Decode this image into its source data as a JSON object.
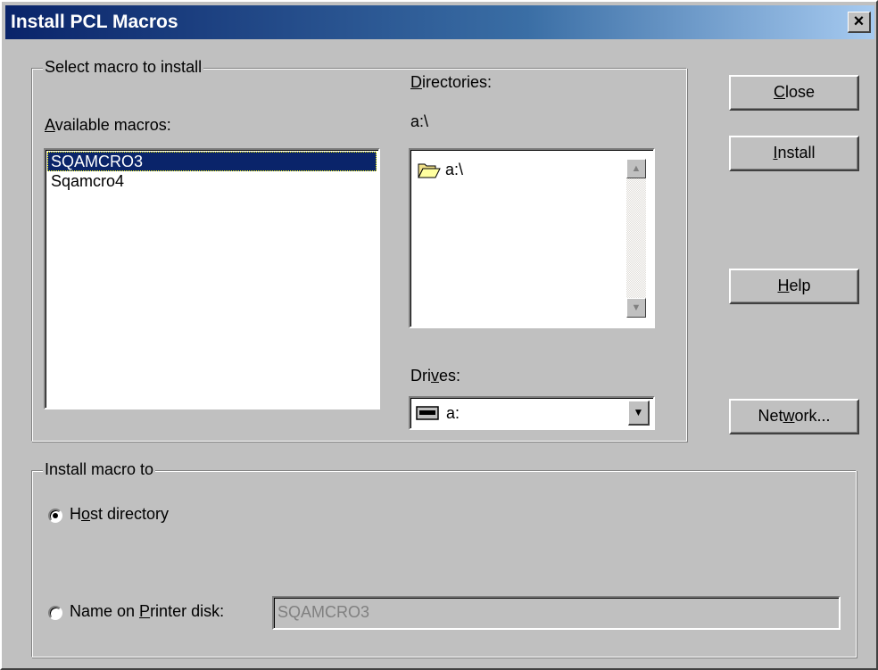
{
  "window": {
    "title": "Install PCL Macros",
    "close_glyph": "×"
  },
  "select_group": {
    "label": "Select macro to install",
    "available_label": "Available macros:",
    "macros": [
      {
        "name": "SQAMCRO3",
        "selected": true
      },
      {
        "name": "Sqamcro4",
        "selected": false
      }
    ],
    "directories_label": "Directories:",
    "current_path": "a:\\",
    "directory_items": [
      {
        "name": "a:\\",
        "icon": "open-folder-icon"
      }
    ],
    "drives_label": "Drives:",
    "drive_value": "a:",
    "drive_icon": "floppy-drive-icon"
  },
  "buttons": {
    "close": "Close",
    "install": "Install",
    "help": "Help",
    "network": "Network..."
  },
  "install_group": {
    "label": "Install macro to",
    "host_option": "Host directory",
    "host_selected": true,
    "printer_option": "Name on Printer disk:",
    "printer_selected": false,
    "printer_name_value": "SQAMCRO3"
  },
  "colors": {
    "selection": "#0a246a",
    "title_gradient_start": "#0a246a",
    "title_gradient_end": "#a6caf0",
    "face": "#c0c0c0"
  }
}
